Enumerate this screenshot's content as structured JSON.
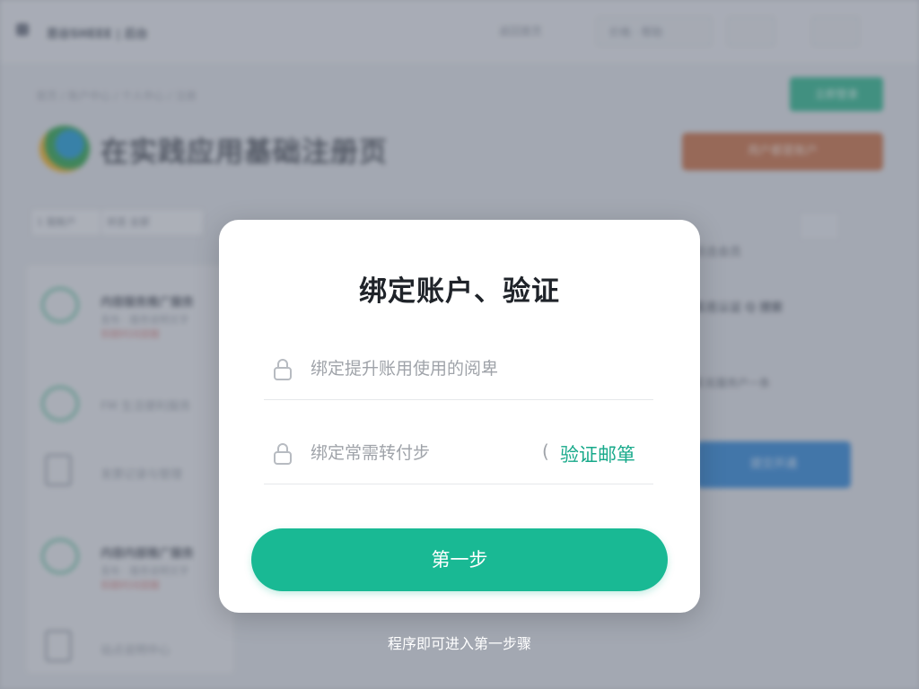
{
  "background": {
    "brand": "思谷SHEEE | 后台",
    "topnav": [
      "返回首页",
      "价格 · 帮助"
    ],
    "breadcrumb": "首页 / 账户中心 / 个人中心 / 注册",
    "help_button": "立即登录",
    "page_title": "在实践应用基础注册页",
    "primary_button": "用户都是账户",
    "filters": [
      "1 我账户",
      "状态 全部"
    ],
    "list_items": [
      {
        "title": "内容服务推广服务",
        "sub": "发布 · 服务说明文字",
        "red": "到期时间提醒"
      },
      {
        "title": "",
        "sub": "FM 生活便利服务",
        "red": ""
      },
      {
        "title": "",
        "sub": "发票记录与管理",
        "red": ""
      },
      {
        "title": "内容内部推广服务",
        "sub": "发布 · 服务说明文字",
        "red": "到期时间提醒"
      },
      {
        "title": "",
        "sub": "站点说明中心",
        "red": ""
      }
    ],
    "right_texts": [
      "点击会员",
      "实名认证  Q 搜索",
      "实名服务户一条",
      "立即开通"
    ],
    "right_button": "提交开通"
  },
  "modal": {
    "title": "绑定账户、验证",
    "fields": [
      {
        "placeholder": "绑定提升账用使用的阅卑",
        "value": ""
      },
      {
        "placeholder": "绑定常需转付步",
        "value": ""
      }
    ],
    "paren": "(",
    "verify_link": "验证邮箪",
    "next_button": "第一步"
  },
  "hint": "程序即可进入第一步骤",
  "colors": {
    "accent": "#19b994",
    "link": "#17a98a",
    "dialog_bg": "#ffffff"
  }
}
